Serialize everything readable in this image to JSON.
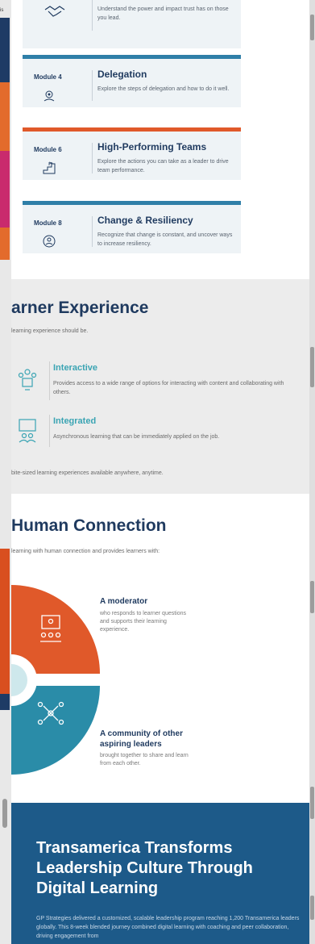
{
  "left_partial_label": "is",
  "cards": {
    "top": {
      "description": "Understand the power and impact trust has on those you lead."
    },
    "items": [
      {
        "module": "Module 4",
        "title": "Delegation",
        "description": "Explore the steps of delegation and how to do it well.",
        "bar_color": "#2f7fa8",
        "icon": "gear-people-icon"
      },
      {
        "module": "Module 6",
        "title": "High-Performing Teams",
        "description": "Explore the actions you can take as a leader to drive team performance.",
        "bar_color": "#e0592a",
        "icon": "steps-flag-icon"
      },
      {
        "module": "Module 8",
        "title": "Change & Resiliency",
        "description": "Recognize that change is constant, and uncover ways to increase resiliency.",
        "bar_color": "#2f7fa8",
        "icon": "cycle-person-icon"
      }
    ]
  },
  "learner": {
    "heading": "arner Experience",
    "subheading": "learning experience should be.",
    "features": [
      {
        "title": "Interactive",
        "description": "Provides access to a wide range of options for interacting with content and collaborating with others.",
        "icon": "interactive-people-icon"
      },
      {
        "title": "Integrated",
        "description": "Asynchronous learning that can be immediately applied on the job.",
        "icon": "presentation-icon"
      }
    ],
    "footer": "bite-sized learning experiences available anywhere, anytime."
  },
  "human": {
    "heading": "Human Connection",
    "subheading": "learning with human connection and provides learners with:",
    "items": [
      {
        "title": "A moderator",
        "description": "who responds to learner questions and supports their learning experience."
      },
      {
        "title": "A community of other aspiring leaders",
        "description": "brought together to share and learn from each other."
      }
    ]
  },
  "transamerica": {
    "heading": "Transamerica Transforms Leadership Culture Through Digital Learning",
    "paragraph": "GP Strategies delivered a customized, scalable leadership program reaching 1,200 Transamerica leaders globally. This 8-week blended journey combined digital learning with coaching and peer collaboration, driving engagement from"
  },
  "colors": {
    "navy": "#1f3a5f",
    "teal": "#3aa4b3",
    "orange": "#e0592a",
    "blue_bar": "#2f7fa8",
    "trans_bg": "#1d5a89"
  }
}
